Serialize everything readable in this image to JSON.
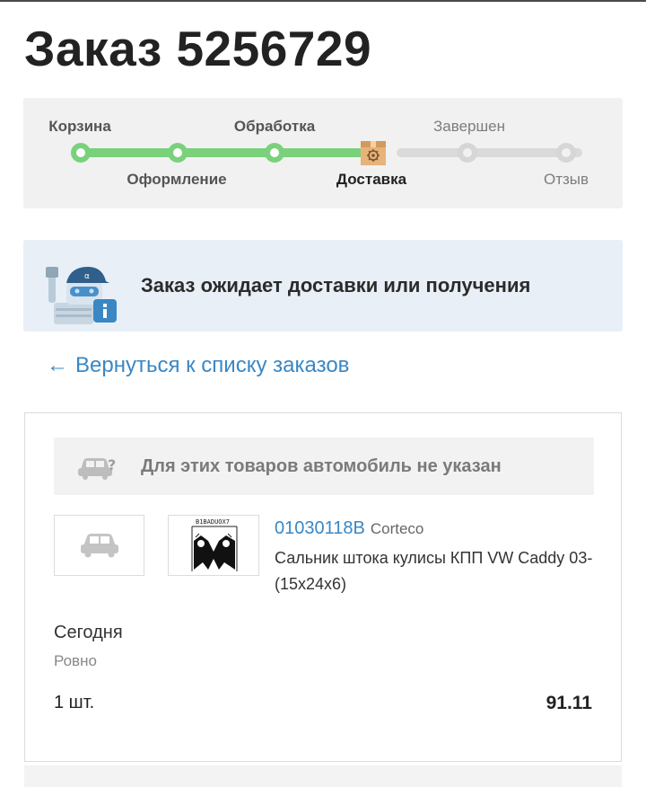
{
  "order": {
    "title": "Заказ 5256729"
  },
  "stepper": {
    "steps": [
      {
        "label": "Корзина",
        "state": "done"
      },
      {
        "label": "Оформление",
        "state": "done"
      },
      {
        "label": "Обработка",
        "state": "done"
      },
      {
        "label": "Доставка",
        "state": "current"
      },
      {
        "label": "Завершен",
        "state": "todo"
      },
      {
        "label": "Отзыв",
        "state": "todo"
      }
    ]
  },
  "status": {
    "text": "Заказ ожидает доставки или получения",
    "icon": "robot-info-icon"
  },
  "back_link": {
    "label": "Вернуться к списку заказов",
    "icon": "arrow-left-icon"
  },
  "card": {
    "no_car_text": "Для этих товаров автомобиль не указан",
    "item": {
      "part_number": "01030118B",
      "brand": "Corteco",
      "description": "Сальник штока кулисы КПП VW Caddy 03- (15x24x6)",
      "image_label": "B1BADUOX7",
      "delivery_day": "Сегодня",
      "delivery_note": "Ровно",
      "quantity": "1 шт.",
      "price": "91.11"
    }
  },
  "colors": {
    "accent": "#3a87c4",
    "progress_done": "#7ad17c",
    "progress_todo": "#d6d6d6",
    "status_bg": "#e8eff6"
  }
}
